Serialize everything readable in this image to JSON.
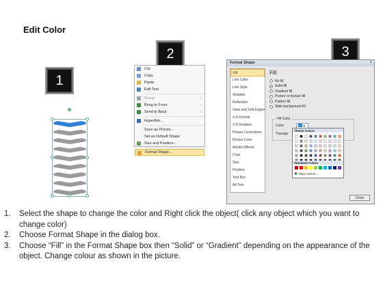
{
  "title": "Edit Color",
  "badges": [
    "1",
    "2",
    "3"
  ],
  "context_menu": {
    "items": [
      {
        "label": "Cut",
        "icon": "cut-icon",
        "disabled": false
      },
      {
        "label": "Copy",
        "icon": "copy-icon",
        "disabled": false
      },
      {
        "label": "Paste",
        "icon": "paste-icon",
        "disabled": false
      },
      {
        "label": "Edit Text",
        "icon": "edit-text-icon",
        "disabled": false
      },
      {
        "label": "Group",
        "icon": "group-icon",
        "disabled": true,
        "submenu": true
      },
      {
        "label": "Bring to Front",
        "icon": "bring-front-icon",
        "disabled": false,
        "submenu": true
      },
      {
        "label": "Send to Back",
        "icon": "send-back-icon",
        "disabled": false,
        "submenu": true
      },
      {
        "label": "Hyperlink...",
        "icon": "hyperlink-icon",
        "disabled": false
      },
      {
        "label": "Save as Picture...",
        "icon": "",
        "disabled": false
      },
      {
        "label": "Set as Default Shape",
        "icon": "",
        "disabled": false
      },
      {
        "label": "Size and Position...",
        "icon": "size-icon",
        "disabled": false
      },
      {
        "label": "Format Shape...",
        "icon": "format-shape-icon",
        "disabled": false,
        "highlighted": true
      }
    ]
  },
  "dialog": {
    "title": "Format Shape",
    "close": "×",
    "nav": [
      "Fill",
      "Line Color",
      "Line Style",
      "Shadow",
      "Reflection",
      "Glow and Soft Edges",
      "3-D Format",
      "3-D Rotation",
      "Picture Corrections",
      "Picture Color",
      "Artistic Effects",
      "Crop",
      "Size",
      "Position",
      "Text Box",
      "Alt Text"
    ],
    "pane_title": "Fill",
    "options": [
      "No fill",
      "Solid fill",
      "Gradient fill",
      "Picture or texture fill",
      "Pattern fill",
      "Slide background fill"
    ],
    "selected_option": "Solid fill",
    "fill_color_group": "Fill Color",
    "color_label": "Color:",
    "transparency_label": "Transpa",
    "close_button": "Close"
  },
  "palette": {
    "theme_label": "Theme Colors",
    "standard_label": "Standard Colors",
    "more_label": "More Colors...",
    "theme_top": [
      "#ffffff",
      "#000000",
      "#eeece1",
      "#1f497d",
      "#4f81bd",
      "#c0504d",
      "#9bbb59",
      "#8064a2",
      "#4bacc6",
      "#f79646"
    ],
    "theme_shades": [
      [
        "#f2f2f2",
        "#7f7f7f",
        "#ddd9c3",
        "#c6d9f0",
        "#dbe5f1",
        "#f2dcdb",
        "#ebf1dd",
        "#e5e0ec",
        "#dbeef3",
        "#fdeada"
      ],
      [
        "#d8d8d8",
        "#595959",
        "#c4bd97",
        "#8db3e2",
        "#b8cce4",
        "#e5b9b7",
        "#d7e3bc",
        "#ccc1d9",
        "#b7dde8",
        "#fbd5b5"
      ],
      [
        "#bfbfbf",
        "#3f3f3f",
        "#938953",
        "#548dd4",
        "#95b3d7",
        "#d99694",
        "#c3d69b",
        "#b2a2c7",
        "#92cddc",
        "#fac08f"
      ],
      [
        "#a5a5a5",
        "#262626",
        "#494429",
        "#17365d",
        "#366092",
        "#953734",
        "#76923c",
        "#5f497a",
        "#31859b",
        "#e36c09"
      ],
      [
        "#7f7f7f",
        "#0c0c0c",
        "#1d1b10",
        "#0f243e",
        "#244061",
        "#632423",
        "#4f6128",
        "#3f3151",
        "#205867",
        "#974806"
      ]
    ],
    "standard": [
      "#c00000",
      "#ff0000",
      "#ffc000",
      "#ffff00",
      "#92d050",
      "#00b050",
      "#00b0f0",
      "#0070c0",
      "#002060",
      "#7030a0"
    ]
  },
  "chevrons": {
    "count": 9,
    "selected_color": "#2f7fd6",
    "gray_color": "#9a9a9a"
  },
  "instructions": [
    {
      "num": "1.",
      "text": "Select the shape to change the color and Right click the object( click any object which you want to change color)"
    },
    {
      "num": "2.",
      "text": "Choose Format Shape in the dialog box."
    },
    {
      "num": "3.",
      "text": "Choose “Fill” in the Format Shape box then “Solid” or “Gradient” depending on the appearance of the object. Change colour as shown in the picture."
    }
  ]
}
